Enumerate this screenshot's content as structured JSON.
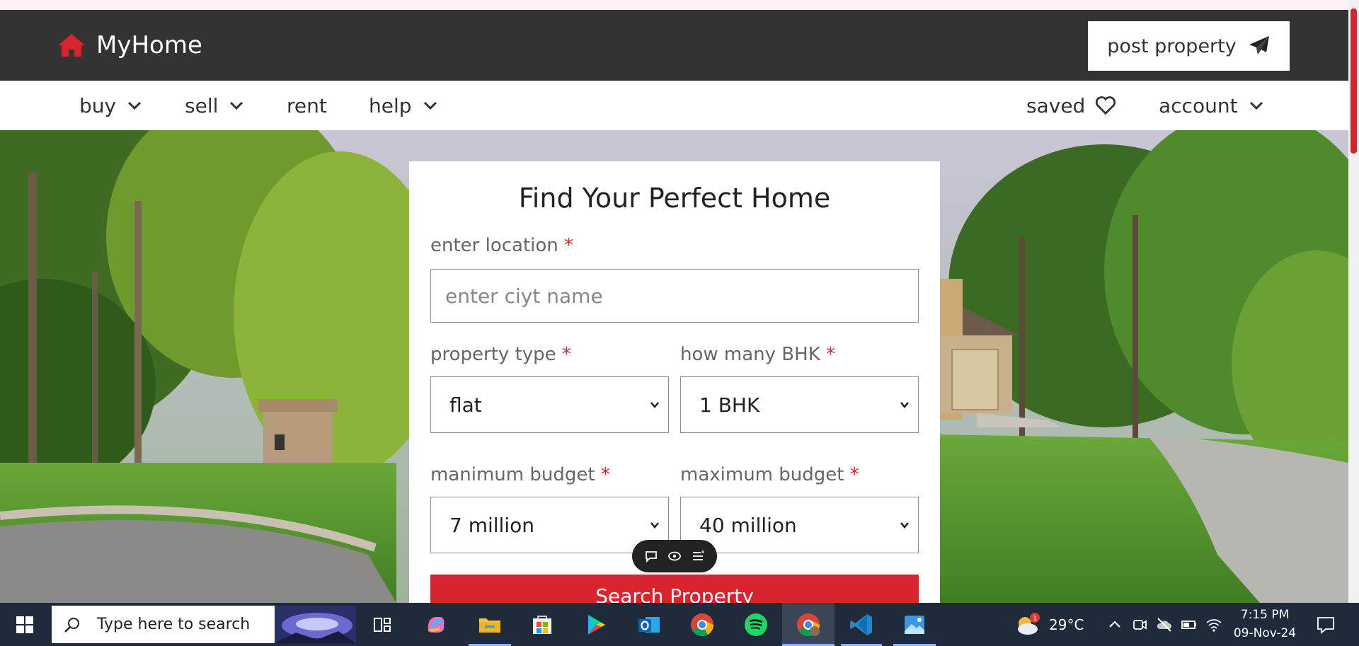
{
  "app": {
    "logo_text": "MyHome",
    "post_property_label": "post property",
    "accent_color": "#d9232e"
  },
  "nav": {
    "buy": "buy",
    "sell": "sell",
    "rent": "rent",
    "help": "help",
    "saved": "saved",
    "account": "account"
  },
  "form": {
    "title": "Find Your Perfect Home",
    "location_label": "enter location",
    "location_placeholder": "enter ciyt name",
    "property_type_label": "property type",
    "property_type_value": "flat",
    "bhk_label": "how many BHK",
    "bhk_value": "1 BHK",
    "min_budget_label": "manimum budget",
    "min_budget_value": "7 million",
    "max_budget_label": "maximum budget",
    "max_budget_value": "40 million",
    "required_mark": "*",
    "search_button": "Search Property"
  },
  "taskbar": {
    "search_placeholder": "Type here to search",
    "weather_temp": "29°C",
    "weather_badge": "1",
    "time": "7:15 PM",
    "date": "09-Nov-24"
  }
}
